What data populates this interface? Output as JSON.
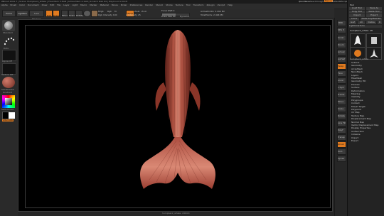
{
  "title_bar": {
    "text": "ZBrush 2021.7 | Scene: Humpback_Whale | Free Mem 3.5GB | Active Mem 4.1GB | Scratch Disk 64 | PolyCount 2.49 M"
  },
  "menu": [
    "Alpha",
    "Brush",
    "Color",
    "Document",
    "Draw",
    "Edit",
    "File",
    "Layer",
    "Light",
    "Macro",
    "Marker",
    "Material",
    "Movie",
    "Picker",
    "Preferences",
    "Render",
    "Stencil",
    "Stroke",
    "Texture",
    "Tool",
    "Transform",
    "Zplugin",
    "Zscript",
    "Help"
  ],
  "top_right": {
    "quicksave": "QuickSave",
    "seethrough": "See-through 0",
    "menus": "Menus",
    "default_zscript": "DefaultZScript"
  },
  "toolbar": {
    "home_page": "Home Page",
    "lightbox": "LightBox",
    "live_boolean": "Live Boolean",
    "edit": "Edit",
    "draw": "Draw",
    "move": "Move",
    "scale": "Scale",
    "rotate": "Rotate",
    "mrgb": "Mrgb",
    "rgb": "Rgb",
    "m": "M",
    "zadd": "Zadd",
    "zsub": "Zsub",
    "zcut": "Zcut",
    "focal_shift": "Focal Shift 0",
    "draw_size": "Draw Size 64",
    "dynamic": "Dynamic",
    "z_intensity": "Z Intensity 25",
    "rgb_intensity": "Rgb Intensity 100",
    "active_points": "ActivePoints: 2.494 Mil",
    "total_points": "TotalPoints: 2.494 Mil"
  },
  "left_shelf": {
    "brush": "Standard",
    "stroke": "Dots",
    "alpha": "Alpha Off",
    "texture": "Texture Off",
    "material": "SkinShade4",
    "gradient": "Gradient",
    "switch_color": "SwitchColor",
    "alternate": "Alternate",
    "primary_color": "#ffffff",
    "secondary_color": "#000000"
  },
  "right_shelf": [
    "BPR",
    "SPix 3",
    "Scroll",
    "Zoom",
    "Actual",
    "AAHalf",
    "Persp",
    "Floor",
    "Local",
    "L.Sym",
    "Frame",
    "Move",
    "Scale",
    "Rotate",
    "Line Fill",
    "PolyF",
    "Transp",
    "Ghost",
    "Solo",
    "Xpose"
  ],
  "tool_panel": {
    "header": "Tool",
    "buttons": [
      "Load Tool",
      "Save As",
      "Copy Tool",
      "Paste Tool",
      "Import",
      "Export",
      "Clone",
      "Make PolyMesh3D",
      "GoZ",
      "All",
      "Visible",
      "R"
    ],
    "lightbox_tools": "Lightbox▸Tools",
    "current_tool": "humpback_whale. 48",
    "tool_names": [
      "humpback_whale",
      "SimpleBrush",
      "Cylinder3D",
      "PM3D_humpback"
    ],
    "sections": [
      "Subtool",
      "Geometry",
      "ArrayMesh",
      "NanoMesh",
      "Layers",
      "FiberMesh",
      "Geometry HD",
      "Preview",
      "Surface",
      "Deformation",
      "Masking",
      "Visibility",
      "Polygroups",
      "Contact",
      "Morph Target",
      "Polypaint",
      "UV Map",
      "Texture Map",
      "Displacement Map",
      "Normal Map",
      "Vector Displacement Map",
      "Display Properties",
      "Unified Skin",
      "Initialize",
      "Import",
      "Export"
    ]
  },
  "viewport": {
    "footer": "humpback_whale: 2494 K"
  },
  "colors": {
    "accent": "#e07a1f",
    "model_base": "#a8473a",
    "model_highlight": "#d98874",
    "model_shadow": "#5a1f18",
    "viewport_bg": "#000000"
  }
}
